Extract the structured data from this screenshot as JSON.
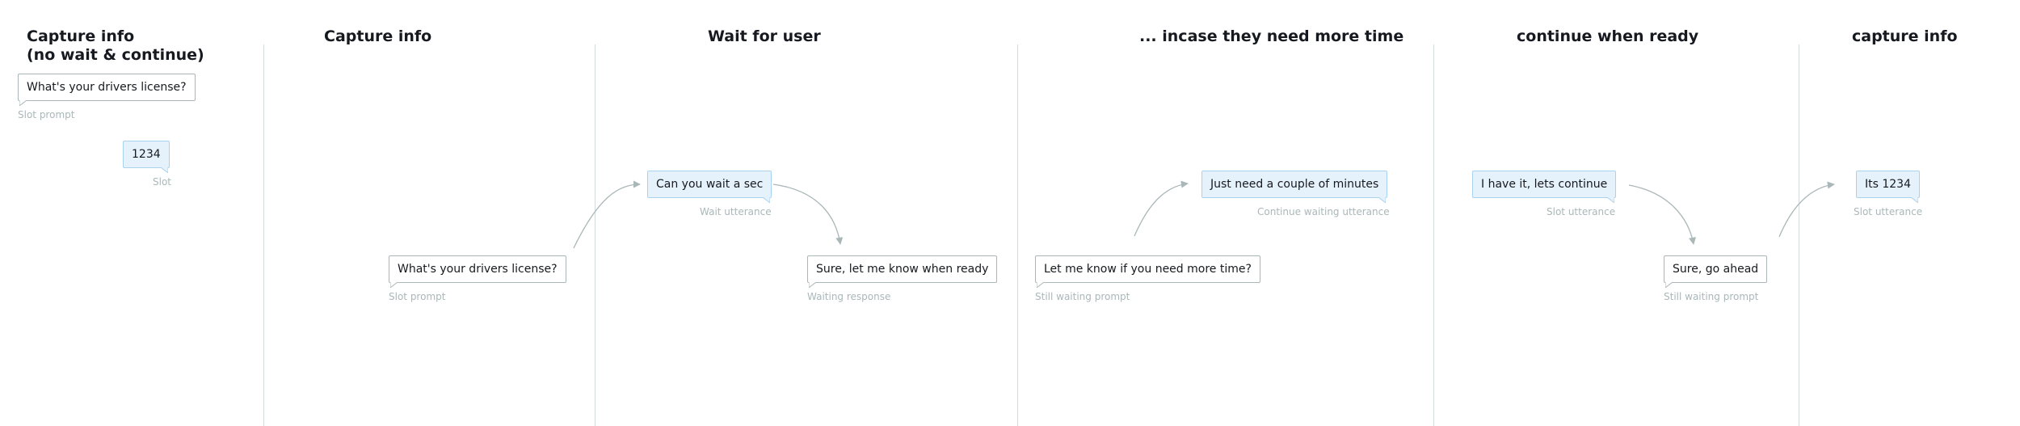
{
  "columns": [
    {
      "title": "Capture info\n(no wait & continue)"
    },
    {
      "title": "Capture info"
    },
    {
      "title": "Wait for user"
    },
    {
      "title": "... incase they need more time"
    },
    {
      "title": "continue when ready"
    },
    {
      "title": "capture info"
    }
  ],
  "messages": [
    {
      "text": "What's your drivers license?",
      "caption": "Slot prompt",
      "role": "prompt"
    },
    {
      "text": "1234",
      "caption": "Slot",
      "role": "user"
    },
    {
      "text": "What's your drivers license?",
      "caption": "Slot prompt",
      "role": "prompt"
    },
    {
      "text": "Can you wait a sec",
      "caption": "Wait utterance",
      "role": "user"
    },
    {
      "text": "Sure, let me know when ready",
      "caption": "Waiting response",
      "role": "prompt"
    },
    {
      "text": "Let me know if you need more time?",
      "caption": "Still waiting prompt",
      "role": "prompt"
    },
    {
      "text": "Just need a couple of minutes",
      "caption": "Continue waiting utterance",
      "role": "user"
    },
    {
      "text": "I have it, lets continue",
      "caption": "Slot utterance",
      "role": "user"
    },
    {
      "text": "Sure, go ahead",
      "caption": "Still waiting prompt",
      "role": "prompt"
    },
    {
      "text": "Its 1234",
      "caption": "Slot utterance",
      "role": "user"
    }
  ],
  "colors": {
    "prompt_border": "#aab7b8",
    "user_fill": "#e6f2fb",
    "user_border": "#a9d2ef",
    "caption": "#aab7b8",
    "divider": "#d5dbdb",
    "connector": "#aab7b8"
  }
}
